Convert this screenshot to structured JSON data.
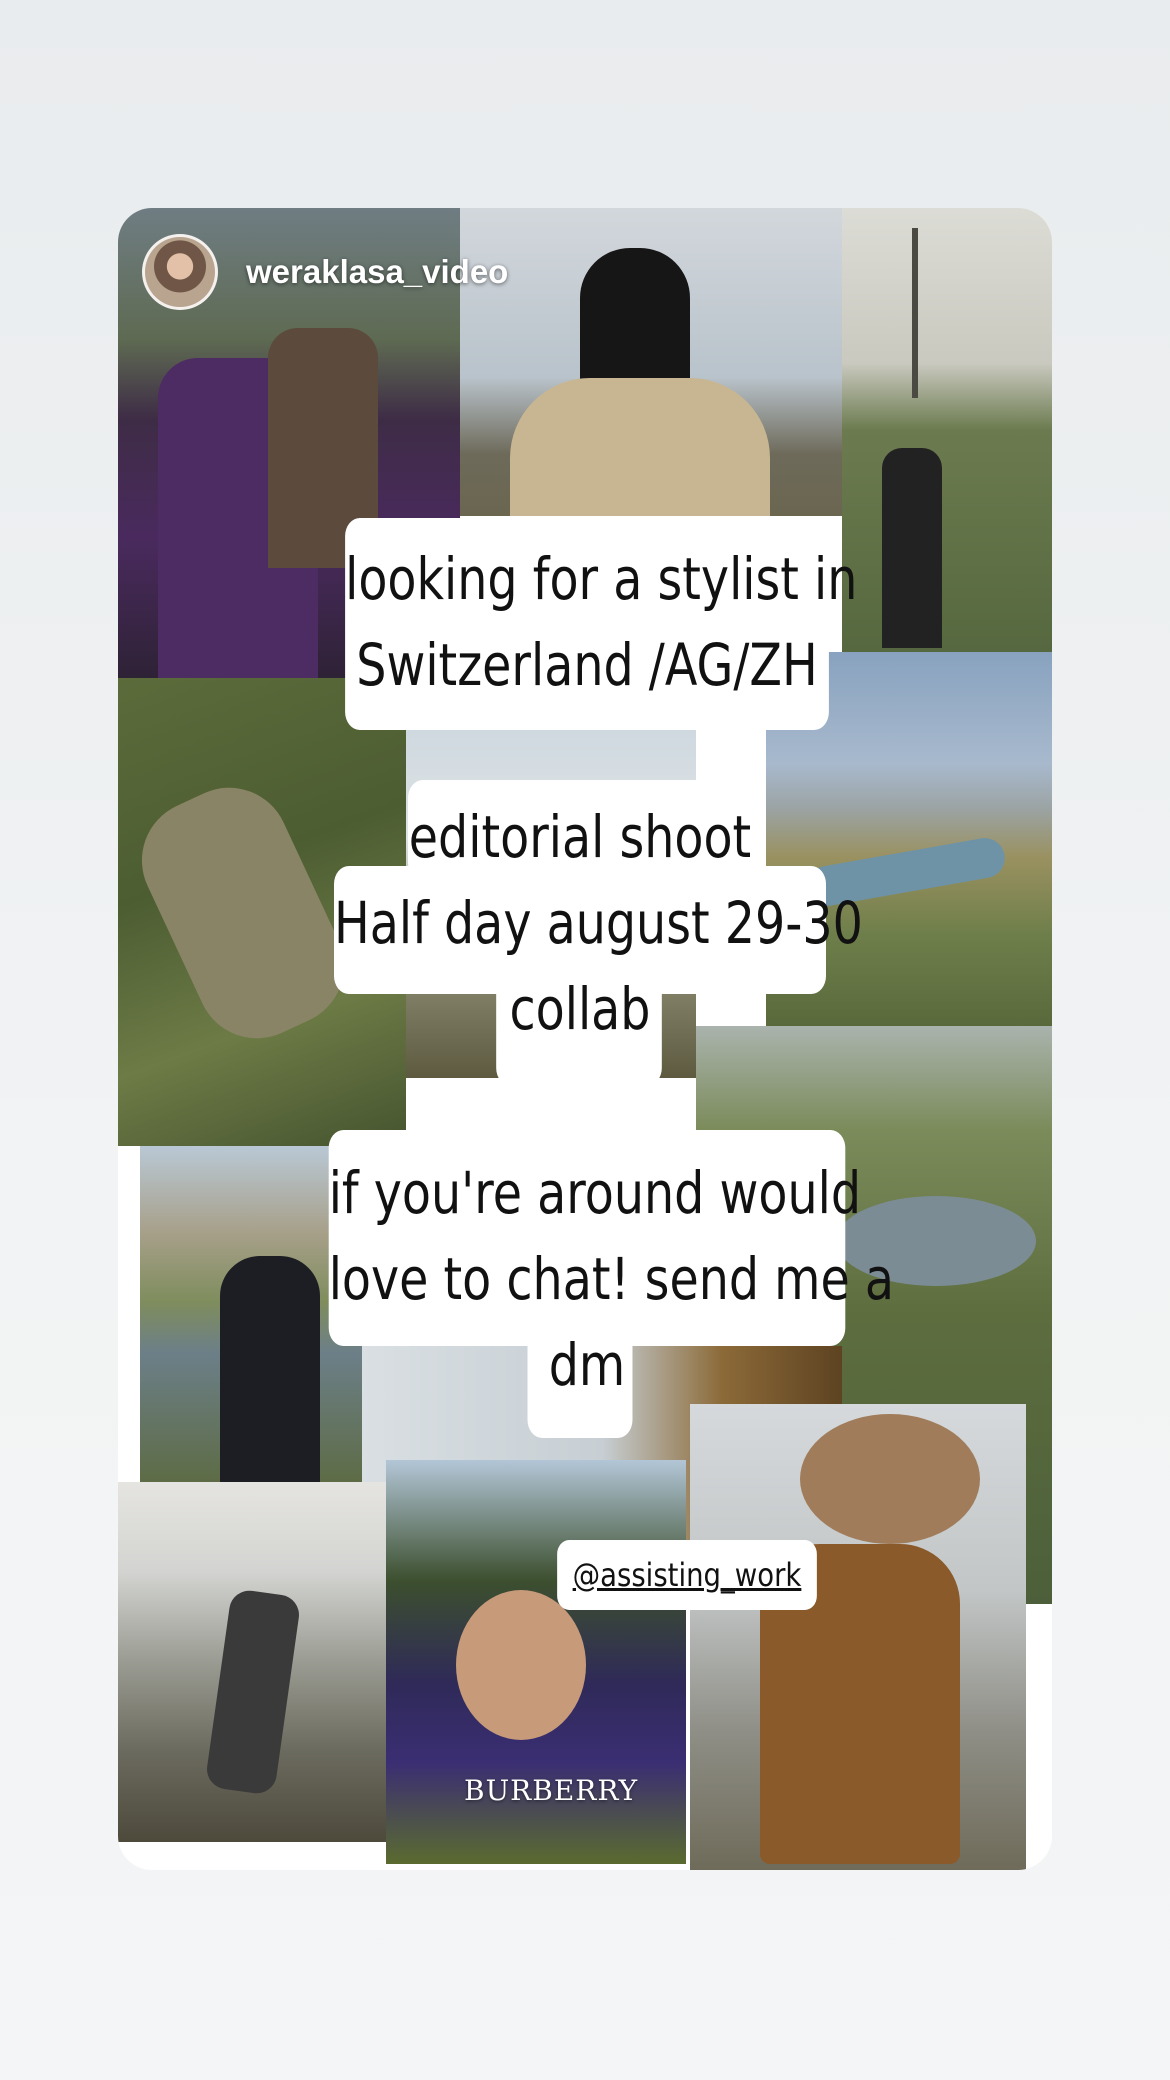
{
  "story": {
    "username": "weraklasa_video",
    "headline_lines": [
      "looking for a stylist in",
      "Switzerland /AG/ZH"
    ],
    "details_lines": [
      "editorial shoot",
      "Half day august 29-30",
      "collab"
    ],
    "cta_lines": [
      "if you're around would",
      "love to chat! send me a",
      "dm"
    ],
    "mention": "@assisting_work",
    "brand_caption": "BURBERRY"
  },
  "colors": {
    "background": "#eceff1",
    "card": "#ffffff",
    "text": "#111111"
  }
}
